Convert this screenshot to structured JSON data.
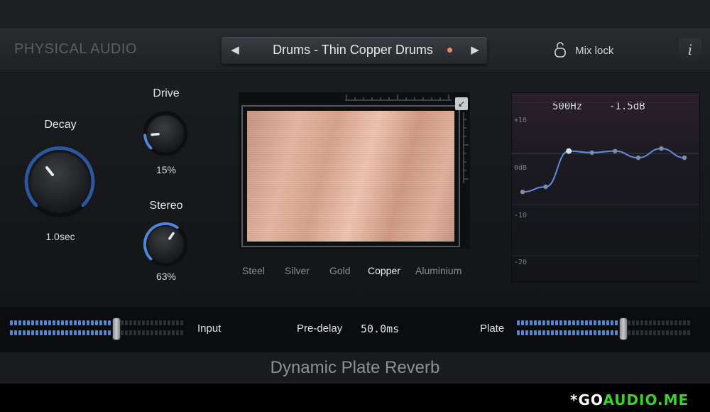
{
  "brand": "PHYSICAL AUDIO",
  "preset": {
    "prev_icon": "◀",
    "next_icon": "▶",
    "name": "Drums - Thin Copper Drums",
    "modified_dot_color": "#e88a6a"
  },
  "mix_lock": {
    "label": "Mix lock",
    "icon": "lock-icon"
  },
  "info_button": {
    "label": "i"
  },
  "knobs": {
    "decay": {
      "label": "Decay",
      "value": "1.0sec"
    },
    "drive": {
      "label": "Drive",
      "value": "15%",
      "level": 0.15
    },
    "stereo": {
      "label": "Stereo",
      "value": "63%",
      "level": 0.63
    }
  },
  "plate": {
    "corner_icon": "↙",
    "materials": [
      "Steel",
      "Silver",
      "Gold",
      "Copper",
      "Aluminium"
    ],
    "selected_material": "Copper"
  },
  "eq": {
    "freq_readout": "500Hz",
    "gain_readout": "-1.5dB",
    "db_ticks": [
      "+10",
      "0dB",
      "-10",
      "-20"
    ],
    "curve_color": "#5b8fe0",
    "chart_data": {
      "type": "line",
      "ylim": [
        -25,
        12
      ],
      "yticks": [
        10,
        0,
        -10,
        -20
      ],
      "series": [
        {
          "values": [
            -7.5,
            -6.5,
            0.5,
            0.2,
            0.5,
            -0.8,
            1.0,
            -0.8
          ]
        }
      ]
    }
  },
  "meters": {
    "input": {
      "label": "Input",
      "level": 0.62
    },
    "plate": {
      "label": "Plate",
      "level": 0.62
    },
    "active_color": "#4f86d8"
  },
  "predelay": {
    "label": "Pre-delay",
    "value": "50.0ms"
  },
  "product_name": "Dynamic Plate Reverb",
  "watermark": {
    "part1": "*GO",
    "part2": "AUDIO.ME"
  }
}
